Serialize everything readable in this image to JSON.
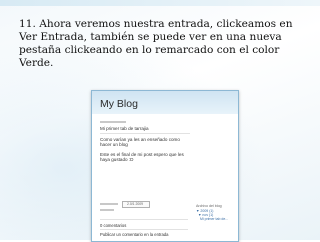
{
  "caption": "11. Ahora veremos nuestra entrada, clickeamos en Ver Entrada, también se puede ver en una nueva pestaña clickeando en lo remarcado con el color Verde.",
  "screenshot": {
    "blog_title": "My Blog",
    "post_title": "Mi primer tab de tarrajia",
    "body_line1": "Como varían ya les an enseñado como",
    "body_line2": "hacer un blog",
    "body_line3": "Este es el final de mi post espero que les",
    "body_line4": "haya gustado :D",
    "share_label": "2.0/1 2009",
    "comments_label": "0 comentarios",
    "publish_link": "Publicar un comentario en la entrada",
    "sidebar_heading": "Archivo del blog",
    "sidebar_item1": "▼ 2009 (1)",
    "sidebar_item2": "▼ nov (1)",
    "sidebar_item3": "Mi primer tab de..."
  }
}
